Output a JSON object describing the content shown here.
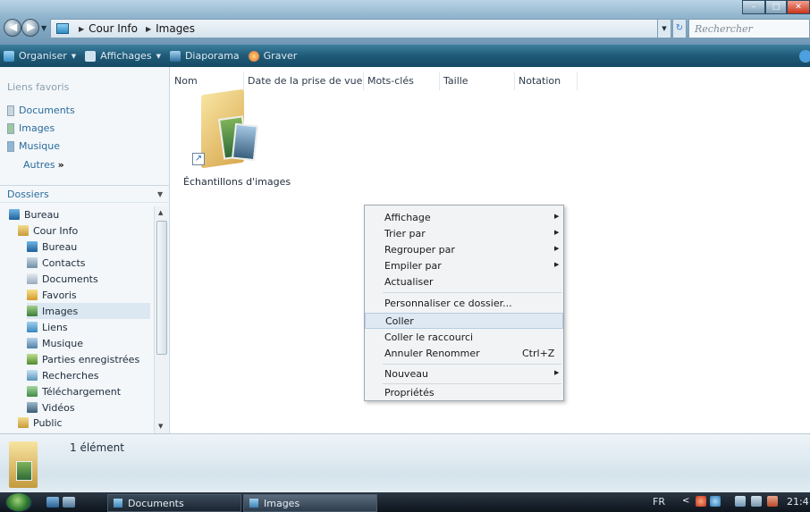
{
  "window": {
    "breadcrumb": [
      "Cour Info",
      "Images"
    ],
    "search_placeholder": "Rechercher"
  },
  "toolbar": {
    "items": [
      {
        "label": "Organiser",
        "icon": "organize-icon",
        "has_dropdown": true
      },
      {
        "label": "Affichages",
        "icon": "views-icon",
        "has_dropdown": true
      },
      {
        "label": "Diaporama",
        "icon": "slideshow-icon",
        "has_dropdown": false
      },
      {
        "label": "Graver",
        "icon": "burn-icon",
        "has_dropdown": false
      }
    ]
  },
  "favorites": {
    "header": "Liens favoris",
    "items": [
      "Documents",
      "Images",
      "Musique"
    ],
    "more_label": "Autres",
    "more_glyph": "»"
  },
  "folders": {
    "header": "Dossiers",
    "tree": [
      {
        "label": "Bureau",
        "icon": "desktop-icon"
      },
      {
        "label": "Cour Info",
        "icon": "user-folder-icon"
      },
      {
        "label": "Bureau",
        "icon": "desktop-icon"
      },
      {
        "label": "Contacts",
        "icon": "contacts-icon"
      },
      {
        "label": "Documents",
        "icon": "documents-icon"
      },
      {
        "label": "Favoris",
        "icon": "favorites-icon"
      },
      {
        "label": "Images",
        "icon": "pictures-icon",
        "selected": true
      },
      {
        "label": "Liens",
        "icon": "links-icon"
      },
      {
        "label": "Musique",
        "icon": "music-icon"
      },
      {
        "label": "Parties enregistrées",
        "icon": "saved-games-icon"
      },
      {
        "label": "Recherches",
        "icon": "searches-icon"
      },
      {
        "label": "Téléchargement",
        "icon": "downloads-icon"
      },
      {
        "label": "Vidéos",
        "icon": "videos-icon"
      },
      {
        "label": "Public",
        "icon": "public-folder-icon"
      }
    ]
  },
  "columns": [
    "Nom",
    "Date de la prise de vue",
    "Mots-clés",
    "Taille",
    "Notation"
  ],
  "files": [
    {
      "label": "Échantillons d'images",
      "icon": "folder-shortcut-icon"
    }
  ],
  "context_menu": {
    "items": [
      {
        "label": "Affichage",
        "submenu": true
      },
      {
        "label": "Trier par",
        "submenu": true
      },
      {
        "label": "Regrouper par",
        "submenu": true
      },
      {
        "label": "Empiler par",
        "submenu": true
      },
      {
        "label": "Actualiser"
      },
      {
        "separator": true
      },
      {
        "label": "Personnaliser ce dossier..."
      },
      {
        "separator": true
      },
      {
        "label": "Coller",
        "highlighted": true
      },
      {
        "label": "Coller le raccourci"
      },
      {
        "label": "Annuler Renommer",
        "shortcut": "Ctrl+Z"
      },
      {
        "separator": true
      },
      {
        "label": "Nouveau",
        "submenu": true
      },
      {
        "separator": true
      },
      {
        "label": "Propriétés"
      }
    ]
  },
  "details": {
    "count_text": "1 élément"
  },
  "taskbar": {
    "buttons": [
      "Documents",
      "Images"
    ],
    "language": "FR",
    "clock": "21:4"
  },
  "colors": {
    "toolbar": "#1f5a78",
    "link": "#2a6b9b",
    "selection": "#dbe8f1"
  }
}
